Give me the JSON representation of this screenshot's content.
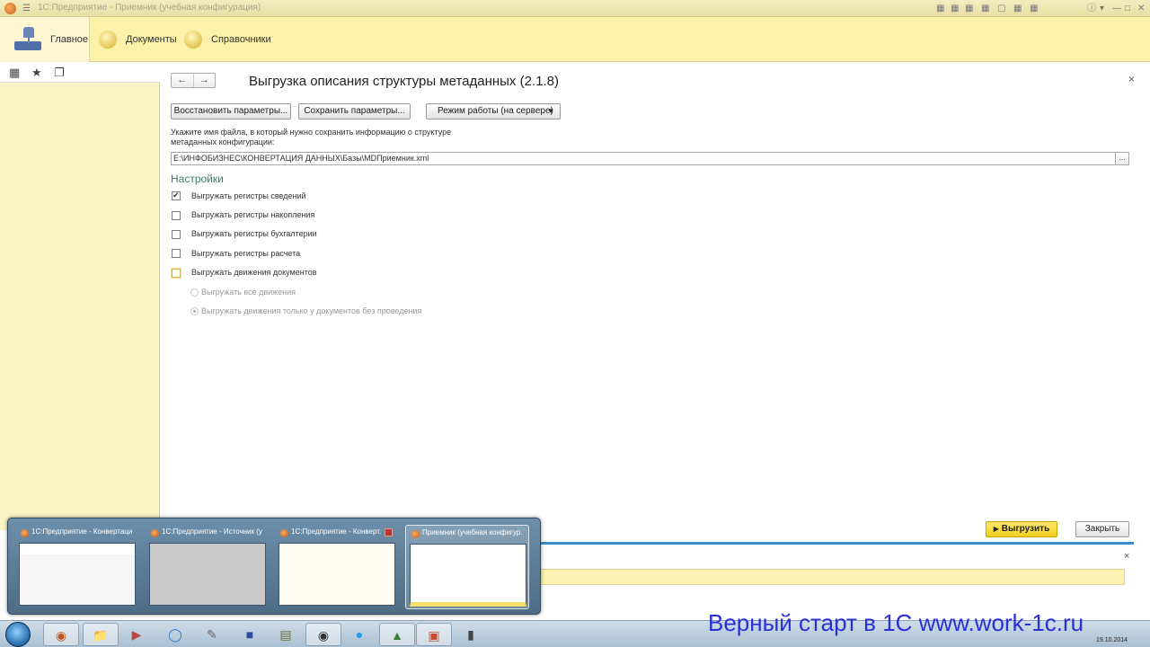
{
  "window": {
    "title": "1С:Предприятие - Приемник (учебная конфигурация)"
  },
  "sections": [
    {
      "label": "Главное",
      "active": true
    },
    {
      "label": "Документы",
      "active": false
    },
    {
      "label": "Справочники",
      "active": false
    }
  ],
  "form": {
    "nav_back": "←",
    "nav_forward": "→",
    "title": "Выгрузка описания структуры метаданных (2.1.8)",
    "close": "×",
    "buttons": {
      "restore": "Восстановить параметры...",
      "save": "Сохранить параметры...",
      "mode": "Режим работы (на сервере)"
    },
    "hint": "Укажите имя файла, в который нужно сохранить информацию о структуре метаданных конфигурации:",
    "file_path": "E:\\ИНФОБИЗНЕС\\КОНВЕРТАЦИЯ ДАННЫХ\\Базы\\MDПриемник.xml",
    "file_browse": "...",
    "settings_title": "Настройки",
    "checkboxes": [
      {
        "label": "Выгружать регистры сведений",
        "checked": true
      },
      {
        "label": "Выгружать регистры накопления",
        "checked": false
      },
      {
        "label": "Выгружать регистры бухгалтерии",
        "checked": false
      },
      {
        "label": "Выгружать регистры расчета",
        "checked": false
      },
      {
        "label": "Выгружать движения документов",
        "checked": false
      }
    ],
    "radios": [
      {
        "label": "Выгружать все движения",
        "selected": false
      },
      {
        "label": "Выгружать движения только у документов без проведения",
        "selected": true
      }
    ],
    "export_button": "Выгрузить",
    "close_button": "Закрыть"
  },
  "messages": {
    "close": "×"
  },
  "thumbnails": [
    {
      "label": "1С:Предприятие - Конвертаци...",
      "highlighted": false
    },
    {
      "label": "1С:Предприятие - Источник (у...",
      "highlighted": false
    },
    {
      "label": "1С:Предприятие - Конверт...",
      "highlighted": false
    },
    {
      "label": "Приемник (учебная конфигур...",
      "highlighted": true
    }
  ],
  "taskbar": {
    "clock_date": "19.10.2014"
  },
  "watermark": "Верный старт в 1С www.work-1c.ru"
}
